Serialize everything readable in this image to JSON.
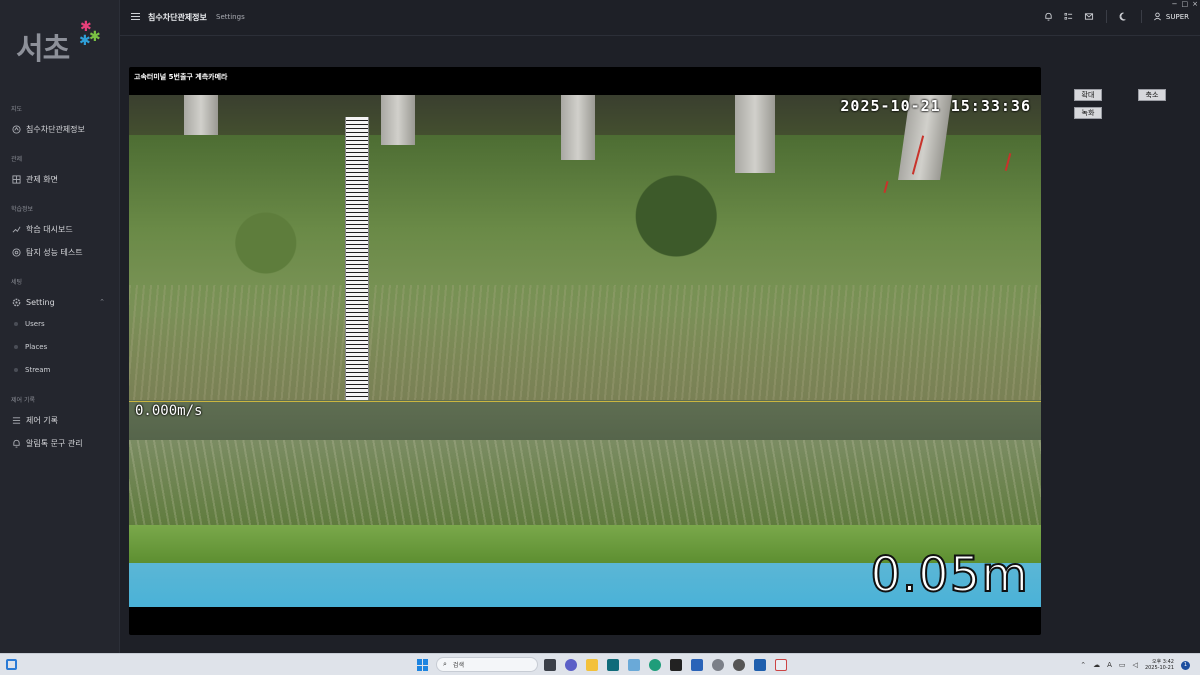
{
  "app": {
    "logo_text": "서초",
    "header_title": "침수차단관제정보",
    "header_crumb": "Settings",
    "user_name": "SUPER"
  },
  "sidebar": {
    "sections": [
      {
        "label": "지도"
      },
      {
        "label": "관제"
      },
      {
        "label": "학습정보"
      },
      {
        "label": "세팅"
      },
      {
        "label": "제어 기록"
      }
    ],
    "items": [
      {
        "label": "침수차단관제정보",
        "icon": "map-icon"
      },
      {
        "label": "관제 화면",
        "icon": "grid-icon"
      },
      {
        "label": "학습 대시보드",
        "icon": "chart-icon"
      },
      {
        "label": "탐지 성능 테스트",
        "icon": "target-icon"
      },
      {
        "label": "Setting",
        "icon": "gear-icon"
      },
      {
        "label": "제어 기록",
        "icon": "list-icon"
      },
      {
        "label": "알림톡 문구 관리",
        "icon": "bell-icon"
      }
    ],
    "sub_items": [
      {
        "label": "Users"
      },
      {
        "label": "Places"
      },
      {
        "label": "Stream"
      }
    ]
  },
  "panel": {
    "title": "고속터미널 5번출구 계측카메라",
    "osd_timestamp": "2025-10-21 15:33:36",
    "osd_speed": "0.000m/s",
    "osd_level": "0.05m"
  },
  "controls": {
    "zoom_in_label": "확대",
    "zoom_out_label": "축소",
    "record_label": "녹화"
  },
  "taskbar": {
    "search_placeholder": "검색",
    "clock_time": "오후 3:42",
    "clock_date": "2025-10-21",
    "notif_count": "1"
  },
  "colors": {
    "sidebar_bg": "#24262e",
    "main_bg": "#1e2027",
    "logo_pink": "#e8407a",
    "logo_green": "#7ac143",
    "logo_blue": "#2f9fd8"
  }
}
